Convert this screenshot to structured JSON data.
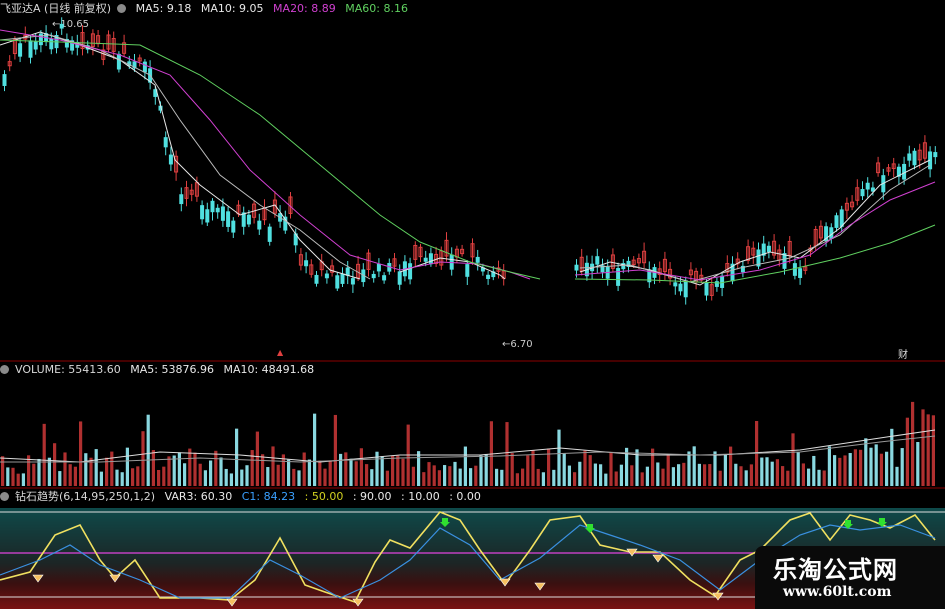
{
  "price_panel": {
    "title": "飞亚达A (日线 前复权)",
    "indicators": [
      {
        "label": "MA5: 9.18",
        "color": "#e8e8e8"
      },
      {
        "label": "MA10: 9.05",
        "color": "#e8e8e8"
      },
      {
        "label": "MA20: 8.89",
        "color": "#d040d0"
      },
      {
        "label": "MA60: 8.16",
        "color": "#60d060"
      }
    ],
    "high_label": "10.65",
    "low_label": "6.70",
    "marker_left": "▲",
    "marker_right": "财"
  },
  "volume_panel": {
    "title": "VOLUME: 55413.60",
    "indicators": [
      {
        "label": "MA5: 53876.96",
        "color": "#e8e8e8"
      },
      {
        "label": "MA10: 48491.68",
        "color": "#e8e8e8"
      }
    ]
  },
  "indicator_panel": {
    "title": "钻石趋势(6,14,95,250,1,2)",
    "indicators": [
      {
        "label": "VAR3: 60.30",
        "color": "#e8e8e8"
      },
      {
        "label": "C1: 84.23",
        "color": "#3aa0ff"
      },
      {
        "label": ": 50.00",
        "color": "#d0d020"
      },
      {
        "label": ": 90.00",
        "color": "#e8e8e8"
      },
      {
        "label": ": 10.00",
        "color": "#e8e8e8"
      },
      {
        "label": ": 0.00",
        "color": "#e8e8e8"
      }
    ]
  },
  "watermark": {
    "title": "乐淘公式网",
    "url": "www.60lt.com"
  },
  "colors": {
    "up": "#e04040",
    "down": "#50e0e0",
    "ma5": "#e8e8e8",
    "ma20": "#d040d0",
    "ma60": "#60d060",
    "separator": "#8b0000"
  }
}
